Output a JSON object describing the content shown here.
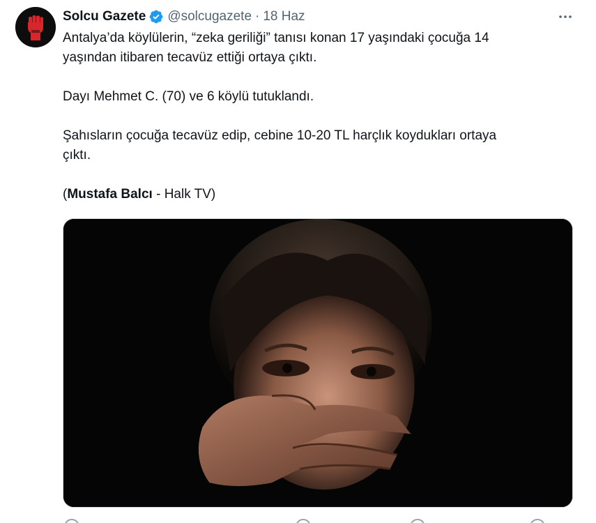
{
  "tweet": {
    "display_name": "Solcu Gazete",
    "handle": "@solcugazete",
    "separator": "·",
    "date": "18 Haz",
    "more_label": "···",
    "verified_icon": "verified-badge-icon",
    "text": {
      "p1_line1": "Antalya’da köylülerin, “zeka geriliği” tanısı konan 17 yaşındaki çocuğa 14",
      "p1_line2": "yaşından itibaren tecavüz ettiği ortaya çıktı.",
      "p2": "Dayı Mehmet C. (70) ve 6 köylü tutuklandı.",
      "p3_line1": "Şahısların çocuğa tecavüz edip, cebine 10-20 TL harçlık koydukları ortaya",
      "p3_line2": "çıktı.",
      "credit_open": "(",
      "credit_author": "Mustafa Balcı",
      "credit_rest": " - Halk TV)"
    },
    "colors": {
      "verified": "#1d9bf0",
      "secondary_text": "#536471",
      "primary_text": "#0f1419",
      "avatar_bg": "#0d0d0d",
      "avatar_fist": "#d7262c"
    }
  }
}
